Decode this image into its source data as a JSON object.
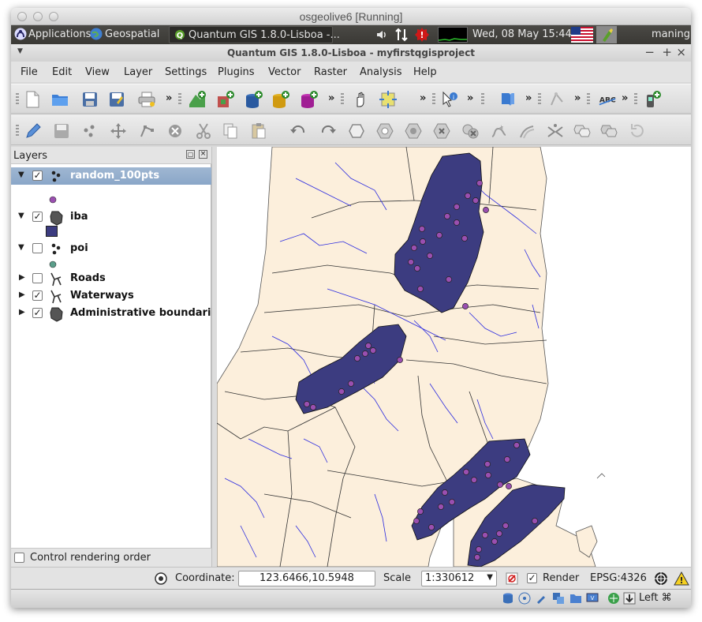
{
  "mac": {
    "title": "osgeolive6 [Running]"
  },
  "ubuntu_panel": {
    "applications": "Applications",
    "geospatial": "Geospatial",
    "task_title": "Quantum GIS 1.8.0-Lisboa -...",
    "datetime": "Wed, 08 May  15:44",
    "user": "maning"
  },
  "qgis": {
    "title": "Quantum GIS 1.8.0-Lisboa - myfirstqgisproject",
    "menu": [
      "File",
      "Edit",
      "View",
      "Layer",
      "Settings",
      "Plugins",
      "Vector",
      "Raster",
      "Analysis",
      "Help"
    ],
    "more_glyph": "»"
  },
  "layers": {
    "title": "Layers",
    "items": [
      {
        "name": "random_100pts",
        "checked": true,
        "expanded": true,
        "selected": true,
        "type": "point",
        "symbol_color": "#9a4fb0"
      },
      {
        "name": "iba",
        "checked": true,
        "expanded": true,
        "selected": false,
        "type": "polygon",
        "symbol_color": "#3c3c80"
      },
      {
        "name": "poi",
        "checked": false,
        "expanded": true,
        "selected": false,
        "type": "point",
        "symbol_color": "#5a9e8a"
      },
      {
        "name": "Roads",
        "checked": false,
        "expanded": false,
        "selected": false,
        "type": "line"
      },
      {
        "name": "Waterways",
        "checked": true,
        "expanded": false,
        "selected": false,
        "type": "line"
      },
      {
        "name": "Administrative boundaries",
        "checked": true,
        "expanded": false,
        "selected": false,
        "type": "polygon"
      }
    ],
    "control_rendering_order": "Control rendering order"
  },
  "map": {
    "land_color": "#fcefdc",
    "iba_color": "#3c3c80",
    "point_color": "#9a4fb0",
    "river_color": "#2a2ae0",
    "background": "#ffffff"
  },
  "status": {
    "coordinate_label": "Coordinate:",
    "coordinate_value": "123.6466,10.5948",
    "scale_label": "Scale",
    "scale_value": "1:330612",
    "render_label": "Render",
    "render_checked": true,
    "crs": "EPSG:4326"
  },
  "vbox": {
    "host_key": "Left ⌘"
  }
}
